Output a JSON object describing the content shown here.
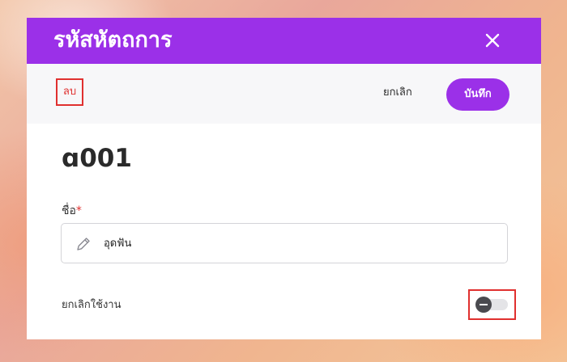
{
  "dialog": {
    "title": "รหัสหัตถการ",
    "close_icon": "close-icon"
  },
  "toolbar": {
    "delete_label": "ลบ",
    "cancel_label": "ยกเลิก",
    "save_label": "บันทึก"
  },
  "record": {
    "code": "ɑ001"
  },
  "form": {
    "name_label": "ชื่อ",
    "required_mark": "*",
    "name_value": "อุดฟัน",
    "name_icon": "pencil-icon",
    "disable_label": "ยกเลิกใช้งาน",
    "disable_toggle_on": false
  },
  "colors": {
    "accent": "#9b30e8",
    "highlight": "#e0302f"
  }
}
